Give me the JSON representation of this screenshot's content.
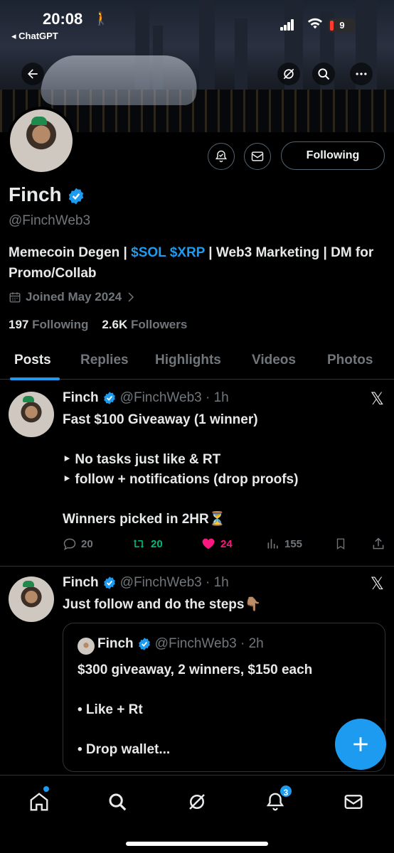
{
  "status_bar": {
    "time": "20:08",
    "back_app": "◂ ChatGPT",
    "battery": "9"
  },
  "profile": {
    "name": "Finch",
    "handle": "@FinchWeb3",
    "bio_prefix": "Memecoin Degen | ",
    "bio_link": "$SOL $XRP",
    "bio_suffix": " | Web3 Marketing | DM for Promo/Collab",
    "joined": "Joined May 2024",
    "following_count": "197",
    "following_label": " Following",
    "followers_count": "2.6K",
    "followers_label": " Followers",
    "follow_button": "Following"
  },
  "tabs": [
    "Posts",
    "Replies",
    "Highlights",
    "Videos",
    "Photos"
  ],
  "tweets": [
    {
      "name": "Finch",
      "handle": "@FinchWeb3 · 1h",
      "line1": "Fast $100 Giveaway (1 winner)",
      "line2": "‣ No tasks just like & RT",
      "line3": "‣ follow + notifications (drop proofs)",
      "line4": "Winners picked in 2HR⏳",
      "replies": "20",
      "retweets": "20",
      "likes": "24",
      "views": "155"
    },
    {
      "name": "Finch",
      "handle": "@FinchWeb3 · 1h",
      "line1": "Just follow and do the steps👇🏽",
      "quote": {
        "name": "Finch",
        "handle": "@FinchWeb3 · 2h",
        "line1": "$300 giveaway, 2 winners, $150 each",
        "line2": "• Like + Rt",
        "line3": "• Drop wallet..."
      }
    }
  ],
  "bottom_nav": {
    "notifications_badge": "3"
  },
  "colors": {
    "accent": "#1d9bf0",
    "retweet": "#00ba7c",
    "like": "#f91880",
    "muted": "#71767b"
  },
  "icons": [
    "back-arrow-icon",
    "grok-icon",
    "search-icon",
    "more-icon",
    "notification-bell-icon",
    "mail-icon",
    "verified-icon",
    "calendar-icon",
    "chevron-right-icon",
    "x-logo-icon",
    "reply-icon",
    "retweet-icon",
    "heart-icon",
    "views-icon",
    "bookmark-icon",
    "share-icon",
    "plus-icon",
    "home-icon"
  ]
}
